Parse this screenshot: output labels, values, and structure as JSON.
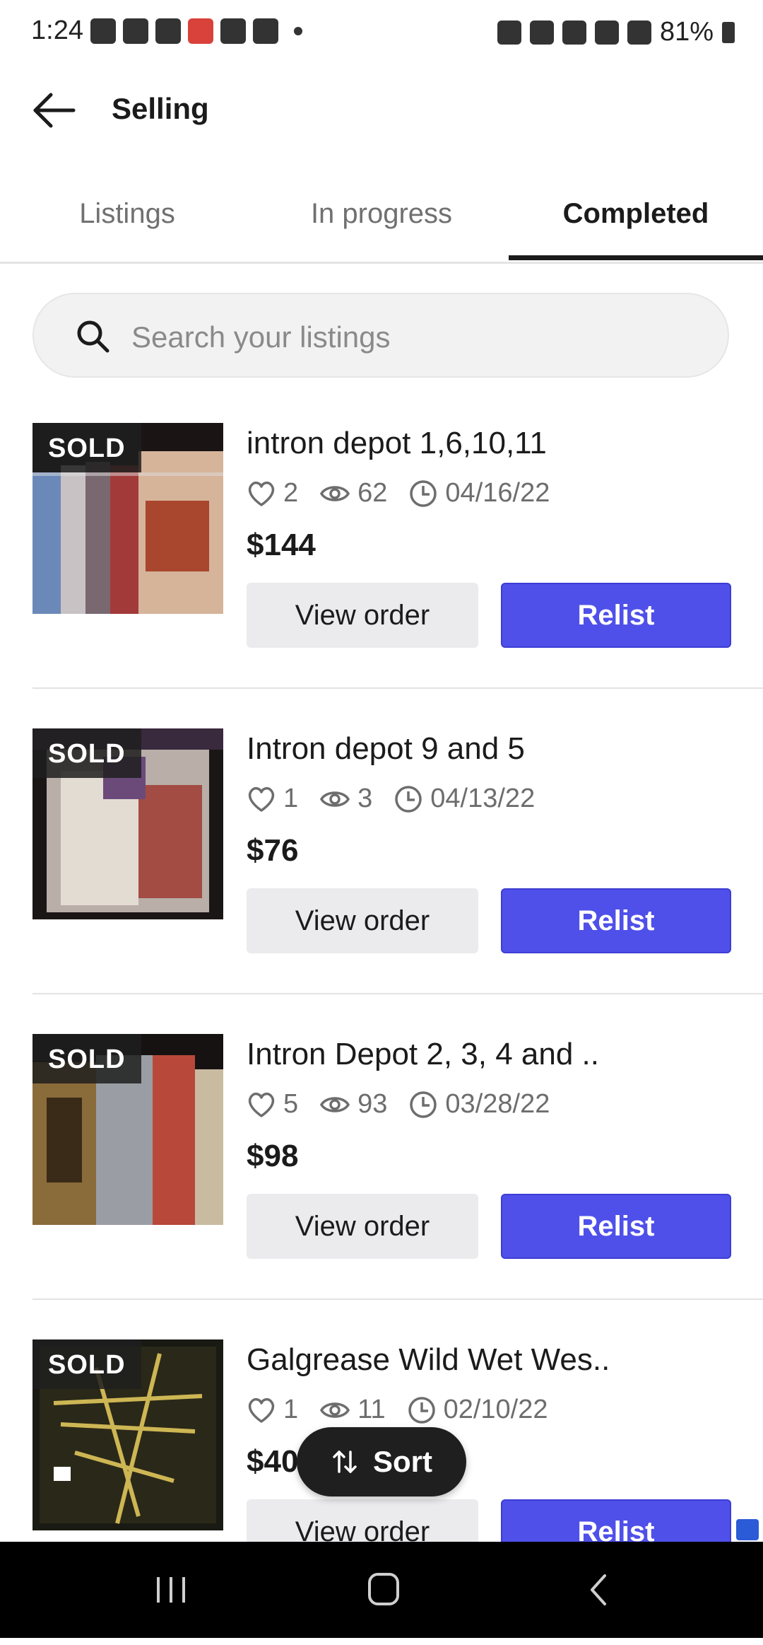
{
  "status_bar": {
    "time": "1:24",
    "battery": "81%"
  },
  "app_bar": {
    "title": "Selling"
  },
  "tabs": [
    {
      "label": "Listings",
      "active": false
    },
    {
      "label": "In progress",
      "active": false
    },
    {
      "label": "Completed",
      "active": true
    }
  ],
  "search": {
    "placeholder": "Search your listings"
  },
  "items": [
    {
      "badge": "SOLD",
      "title": "intron depot 1,6,10,11",
      "likes": "2",
      "views": "62",
      "date": "04/16/22",
      "price": "$144",
      "view_label": "View order",
      "relist_label": "Relist"
    },
    {
      "badge": "SOLD",
      "title": "Intron depot 9 and 5",
      "likes": "1",
      "views": "3",
      "date": "04/13/22",
      "price": "$76",
      "view_label": "View order",
      "relist_label": "Relist"
    },
    {
      "badge": "SOLD",
      "title": "Intron Depot 2, 3, 4 and ..",
      "likes": "5",
      "views": "93",
      "date": "03/28/22",
      "price": "$98",
      "view_label": "View order",
      "relist_label": "Relist"
    },
    {
      "badge": "SOLD",
      "title": "Galgrease Wild Wet Wes..",
      "likes": "1",
      "views": "11",
      "date": "02/10/22",
      "price": "$40",
      "view_label": "View order",
      "relist_label": "Relist"
    }
  ],
  "sort": {
    "label": "Sort"
  },
  "colors": {
    "accent": "#4f50e9",
    "fab": "#1f1f1f",
    "active_tab": "#1b1b1b"
  },
  "icons": [
    "back-arrow-icon",
    "search-icon",
    "heart-icon",
    "eye-icon",
    "clock-icon",
    "sort-icon",
    "recents-icon",
    "home-icon",
    "back-nav-icon"
  ]
}
